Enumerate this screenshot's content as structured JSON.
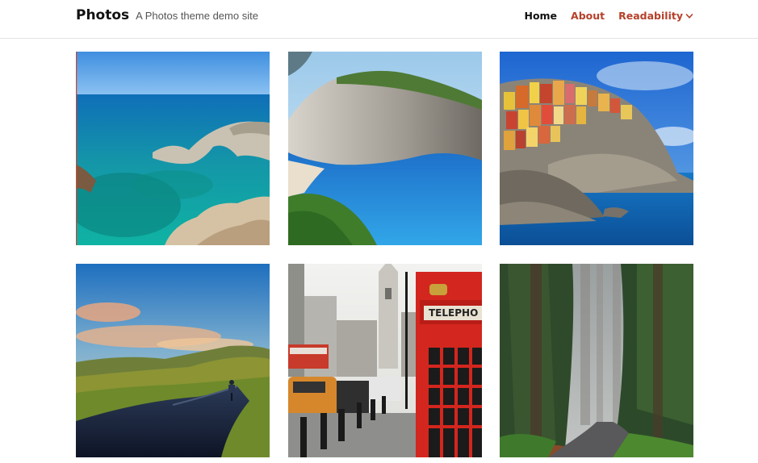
{
  "header": {
    "site_title": "Photos",
    "tagline": "A Photos theme demo site"
  },
  "nav": {
    "items": [
      {
        "label": "Home",
        "active": true
      },
      {
        "label": "About",
        "active": false
      },
      {
        "label": "Readability",
        "active": false,
        "has_dropdown": true
      }
    ]
  },
  "colors": {
    "accent": "#b5412a",
    "text": "#111111",
    "tagline": "#555555",
    "divider": "#e3e3e3"
  },
  "gallery": {
    "photos": [
      {
        "subject": "coastal rock arch over turquoise sea"
      },
      {
        "subject": "cliff cove beach with blue water"
      },
      {
        "subject": "colorful cliffside village by the sea"
      },
      {
        "subject": "cyclist on road through green hills at sunset"
      },
      {
        "subject": "red telephone box on city street"
      },
      {
        "subject": "misty forest road with tall trees"
      }
    ]
  }
}
